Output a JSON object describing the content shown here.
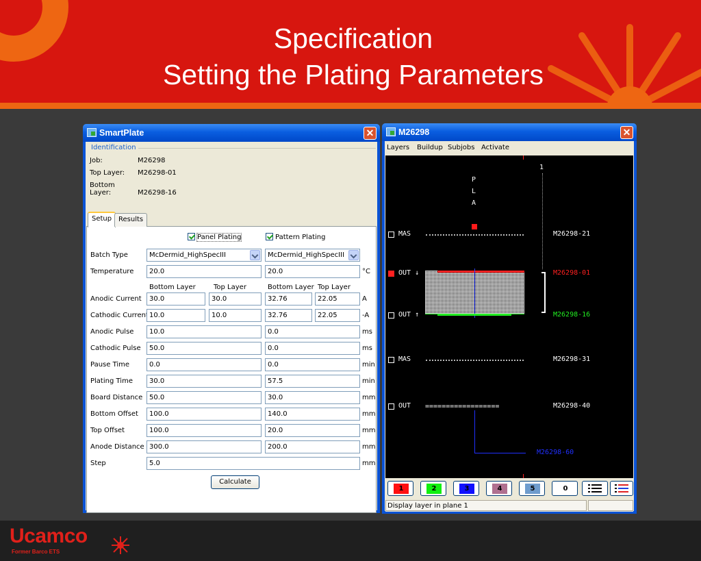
{
  "slide": {
    "title_line1": "Specification",
    "title_line2": "Setting the Plating Parameters",
    "logo": "Ucamco",
    "logo_sub": "Former Barco ETS",
    "colors": {
      "header": "#d7160f",
      "accent": "#ee6612"
    }
  },
  "smartplate": {
    "title": "SmartPlate",
    "identification": {
      "legend": "Identification",
      "rows": [
        {
          "key": "Job:",
          "value": "M26298"
        },
        {
          "key": "Top Layer:",
          "value": "M26298-01"
        },
        {
          "key": "Bottom Layer:",
          "value": "M26298-16"
        }
      ]
    },
    "tabs": [
      {
        "label": "Setup"
      },
      {
        "label": "Results"
      }
    ],
    "panel_plating": {
      "label": "Panel Plating",
      "checked": true
    },
    "pattern_plating": {
      "label": "Pattern Plating",
      "checked": true
    },
    "subheaders": {
      "bottom": "Bottom Layer",
      "top": "Top Layer"
    },
    "batch_type": {
      "label": "Batch Type",
      "panel": "McDermid_HighSpecIII",
      "pattern": "McDermid_HighSpecIII"
    },
    "temperature": {
      "label": "Temperature",
      "panel": "20.0",
      "pattern": "20.0",
      "unit": "°C"
    },
    "anodic_current": {
      "label": "Anodic Current",
      "panel_bottom": "30.0",
      "panel_top": "30.0",
      "pattern_bottom": "32.76",
      "pattern_top": "22.05",
      "unit": "A"
    },
    "cathodic_current": {
      "label": "Cathodic Current",
      "panel_bottom": "10.0",
      "panel_top": "10.0",
      "pattern_bottom": "32.76",
      "pattern_top": "22.05",
      "unit": "-A"
    },
    "rows": [
      {
        "label": "Anodic Pulse",
        "panel": "10.0",
        "pattern": "0.0",
        "unit": "ms"
      },
      {
        "label": "Cathodic Pulse",
        "panel": "50.0",
        "pattern": "0.0",
        "unit": "ms"
      },
      {
        "label": "Pause Time",
        "panel": "0.0",
        "pattern": "0.0",
        "unit": "min"
      },
      {
        "label": "Plating Time",
        "panel": "30.0",
        "pattern": "57.5",
        "unit": "min"
      },
      {
        "label": "Board Distance",
        "panel": "50.0",
        "pattern": "30.0",
        "unit": "mm"
      },
      {
        "label": "Bottom Offset",
        "panel": "100.0",
        "pattern": "140.0",
        "unit": "mm"
      },
      {
        "label": "Top Offset",
        "panel": "100.0",
        "pattern": "20.0",
        "unit": "mm"
      },
      {
        "label": "Anode Distance",
        "panel": "300.0",
        "pattern": "200.0",
        "unit": "mm"
      }
    ],
    "step": {
      "label": "Step",
      "value": "5.0",
      "unit": "mm"
    },
    "calculate_label": "Calculate"
  },
  "viewer": {
    "title": "M26298",
    "menu": [
      "Layers",
      "Buildup",
      "Subjobs",
      "Activate"
    ],
    "canvas": {
      "plane_number": "1",
      "pla": [
        "P",
        "L",
        "A"
      ],
      "layers": [
        {
          "type": "MAS",
          "name": "M26298-21",
          "color": "#ffffff"
        },
        {
          "type": "OUT ↓",
          "name": "M26298-01",
          "color": "#ff2020"
        },
        {
          "type": "OUT ↑",
          "name": "M26298-16",
          "color": "#22ee22"
        },
        {
          "type": "MAS",
          "name": "M26298-31",
          "color": "#ffffff"
        },
        {
          "type": "OUT",
          "name": "M26298-40",
          "color": "#ffffff"
        }
      ],
      "drill_name": "M26298-60",
      "drill_color": "#2030ff",
      "eq_line": "=================="
    },
    "plane_buttons": [
      {
        "label": "1",
        "color": "#ff1010"
      },
      {
        "label": "2",
        "color": "#10f010"
      },
      {
        "label": "3",
        "color": "#1010ff"
      },
      {
        "label": "4",
        "color": "#b07090"
      },
      {
        "label": "5",
        "color": "#6f9ccd"
      },
      {
        "label": "0",
        "color": "#ffffff"
      }
    ],
    "status": "Display layer in plane 1"
  }
}
